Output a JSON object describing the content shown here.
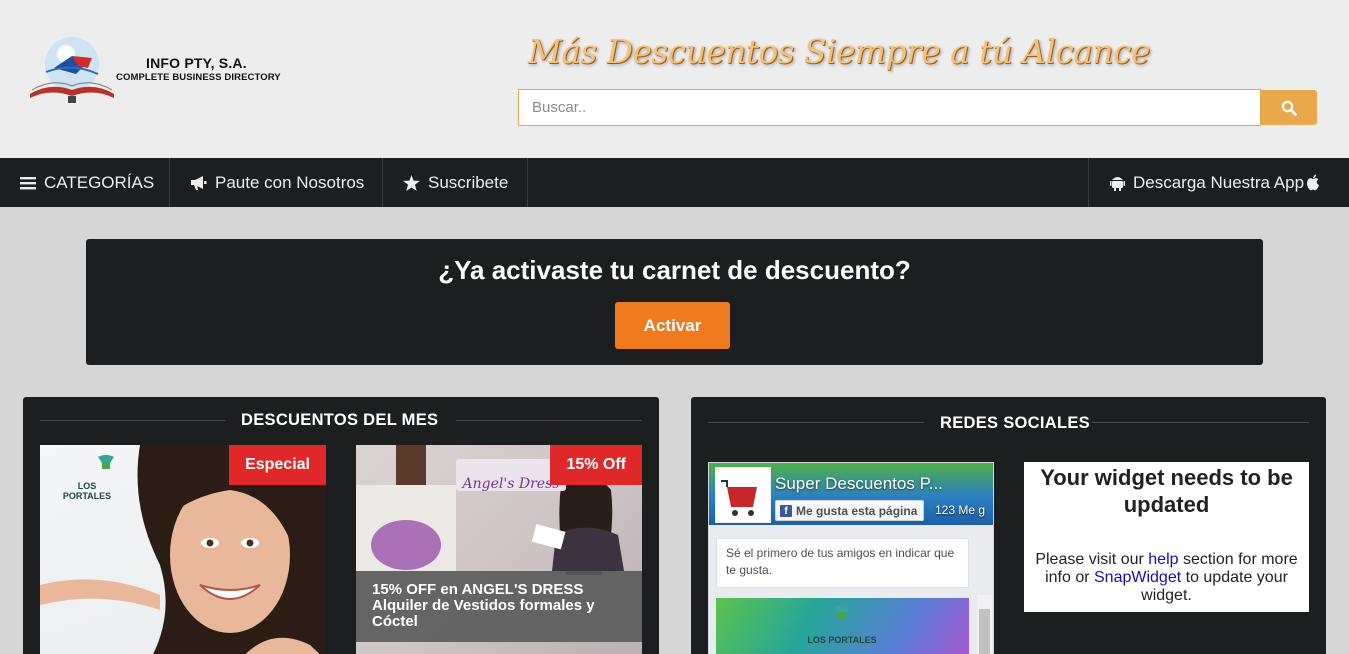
{
  "header": {
    "logo_title": "INFO PTY, S.A.",
    "logo_subtitle": "COMPLETE BUSINESS DIRECTORY",
    "slogan": "Más Descuentos Siempre a tú Alcance",
    "search": {
      "placeholder": "Buscar..",
      "value": "",
      "button_icon": "search-icon"
    },
    "colors": {
      "background": "#ededed",
      "accent": "#e9a84b",
      "slogan": "#f0c27a"
    }
  },
  "navbar": {
    "items": [
      {
        "label": "CATEGORÍAS",
        "icon": "menu-icon"
      },
      {
        "label": "Paute con Nosotros",
        "icon": "megaphone-icon"
      },
      {
        "label": "Suscribete",
        "icon": "star-icon"
      }
    ],
    "app_download": {
      "label": "Descarga Nuestra App",
      "icons": [
        "android-icon",
        "apple-icon"
      ]
    },
    "background": "#1d1e20"
  },
  "carnet": {
    "title": "¿Ya activaste tu carnet de descuento?",
    "button_label": "Activar",
    "button_color": "#f07a1e"
  },
  "deals": {
    "heading": "DESCUENTOS DEL MES",
    "cards": [
      {
        "badge": "Especial",
        "brand": "LOS PORTALES",
        "caption": ""
      },
      {
        "badge": "15% Off",
        "brand": "Angel's Dress",
        "caption": "15% OFF en ANGEL'S DRESS Alquiler de Vestidos formales y Cóctel"
      }
    ],
    "badge_color": "#e0282a"
  },
  "social": {
    "heading": "REDES SOCIALES",
    "facebook": {
      "page_title": "Super Descuentos P...",
      "like_label": "Me gusta esta página",
      "like_count": "123 Me g",
      "note": "Sé el primero de tus amigos en indicar que te gusta.",
      "post_brand": "LOS PORTALES"
    },
    "snapwidget": {
      "title": "Your widget needs to be updated",
      "text_before": "Please visit our ",
      "link1": "help",
      "text_middle": " section for more info or ",
      "link2": "SnapWidget",
      "text_after": " to update your widget."
    }
  }
}
